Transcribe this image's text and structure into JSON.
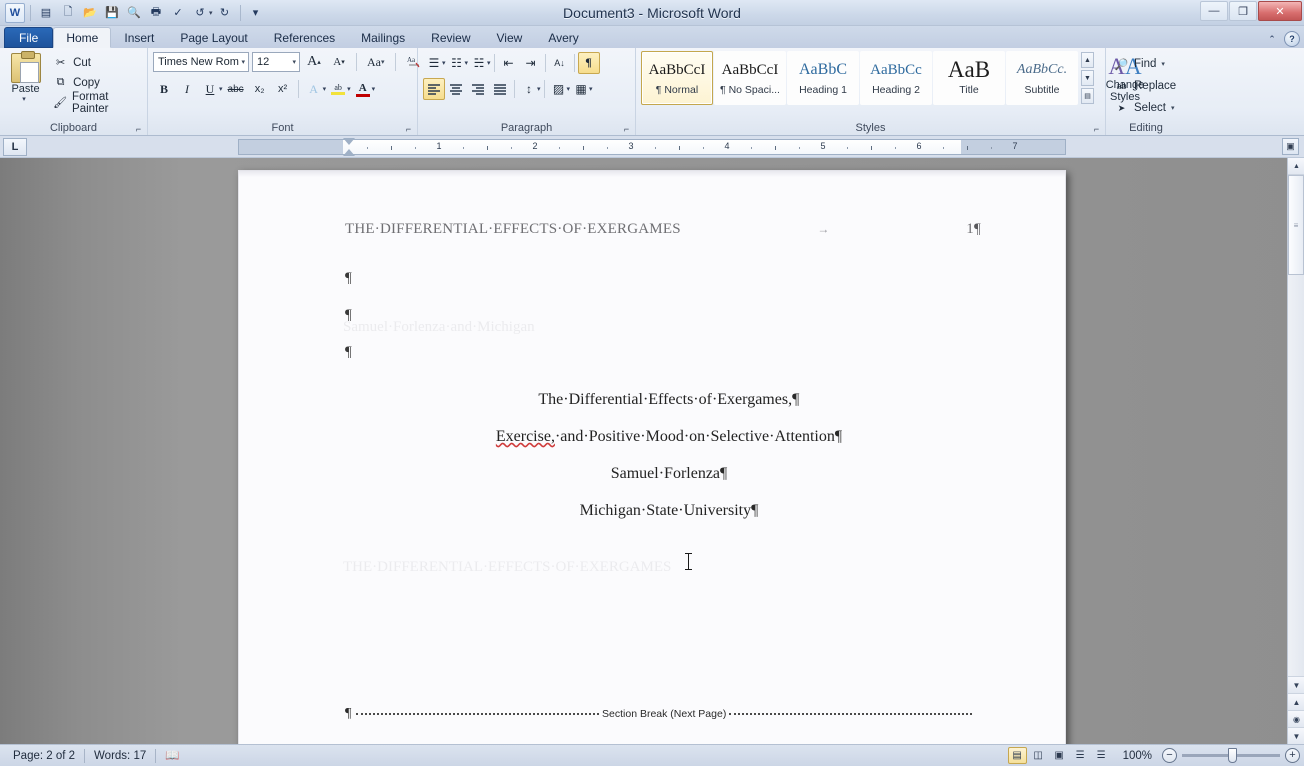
{
  "window": {
    "title": "Document3 - Microsoft Word",
    "minimize": "—",
    "restore": "❐",
    "close": "✕"
  },
  "quick_access": [
    {
      "name": "word-logo-icon",
      "glyph": "W"
    },
    {
      "name": "save-as-icon",
      "glyph": "▤"
    },
    {
      "name": "new-document-icon",
      "glyph": "🗋"
    },
    {
      "name": "open-icon",
      "glyph": "📂"
    },
    {
      "name": "save-icon",
      "glyph": "💾"
    },
    {
      "name": "print-preview-icon",
      "glyph": "🔍"
    },
    {
      "name": "quick-print-icon",
      "glyph": "🖶"
    },
    {
      "name": "spelling-grammar-icon",
      "glyph": "✓"
    },
    {
      "name": "undo-icon",
      "glyph": "↺"
    },
    {
      "name": "redo-icon",
      "glyph": "↻"
    },
    {
      "name": "customize-qat-icon",
      "glyph": "▾"
    }
  ],
  "tabs": [
    {
      "label": "File",
      "state": "file"
    },
    {
      "label": "Home",
      "state": "active"
    },
    {
      "label": "Insert",
      "state": "normal"
    },
    {
      "label": "Page Layout",
      "state": "normal"
    },
    {
      "label": "References",
      "state": "normal"
    },
    {
      "label": "Mailings",
      "state": "normal"
    },
    {
      "label": "Review",
      "state": "normal"
    },
    {
      "label": "View",
      "state": "normal"
    },
    {
      "label": "Avery",
      "state": "normal"
    }
  ],
  "ribbon": {
    "minimize_ribbon": "⌃",
    "help": "?",
    "clipboard": {
      "label": "Clipboard",
      "paste": "Paste",
      "paste_caret": "▾",
      "items": [
        {
          "label": "Cut",
          "icon": "✂"
        },
        {
          "label": "Copy",
          "icon": "⧉"
        },
        {
          "label": "Format Painter",
          "icon": "🖌"
        }
      ],
      "dialog_launcher": "⌐"
    },
    "font": {
      "label": "Font",
      "font_name": "Times New Rom",
      "font_size": "12",
      "grow_font": "A",
      "shrink_font": "A",
      "change_case": "Aa",
      "clear_formatting": "Ab",
      "bold": "B",
      "italic": "I",
      "underline": "U",
      "strikethrough": "abc",
      "subscript": "x₂",
      "superscript": "x²",
      "text_effects": "A",
      "highlight": "ab",
      "font_color": "A",
      "dialog_launcher": "⌐"
    },
    "paragraph": {
      "label": "Paragraph",
      "bullets": "☰",
      "numbering": "☷",
      "multilevel": "☵",
      "decrease_indent": "⇤",
      "increase_indent": "⇥",
      "sort": "A↓",
      "show_marks": "¶",
      "align_left": "☰",
      "align_center": "☰",
      "align_right": "☰",
      "justify": "☰",
      "line_spacing": "↕",
      "shading": "▨",
      "borders": "▦",
      "dialog_launcher": "⌐"
    },
    "styles": {
      "label": "Styles",
      "gallery": [
        {
          "sample": "AaBbCcI",
          "name": "¶ Normal",
          "variant": "normal",
          "selected": true
        },
        {
          "sample": "AaBbCcI",
          "name": "¶ No Spaci...",
          "variant": "normal",
          "selected": false
        },
        {
          "sample": "AaBbC",
          "name": "Heading 1",
          "variant": "h1",
          "selected": false
        },
        {
          "sample": "AaBbCc",
          "name": "Heading 2",
          "variant": "h2",
          "selected": false
        },
        {
          "sample": "AaB",
          "name": "Title",
          "variant": "title",
          "selected": false
        },
        {
          "sample": "AaBbCc.",
          "name": "Subtitle",
          "variant": "subtitle",
          "selected": false
        }
      ],
      "nav_up": "▲",
      "nav_down": "▼",
      "nav_more": "▤",
      "change_styles": "Change Styles",
      "change_styles_caret": "▾",
      "dialog_launcher": "⌐"
    },
    "editing": {
      "label": "Editing",
      "items": [
        {
          "label": "Find",
          "icon": "🔎",
          "caret": "▾"
        },
        {
          "label": "Replace",
          "icon": "ab",
          "caret": ""
        },
        {
          "label": "Select",
          "icon": "➤",
          "caret": "▾"
        }
      ]
    }
  },
  "ruler": {
    "corner_tab_stop": "L",
    "numbers": [
      "1",
      "2",
      "3",
      "4",
      "5",
      "6",
      "7"
    ],
    "toggle_ruler_icon": "▣"
  },
  "document": {
    "header": {
      "text": "THE·DIFFERENTIAL·EFFECTS·OF·EXERGAMES",
      "tab_arrow": "→",
      "page_number": "1",
      "pilcrow": "¶"
    },
    "empty_paragraphs": [
      "¶",
      "¶",
      "¶"
    ],
    "body_lines": [
      {
        "text": "The·Differential·Effects·of·Exergames,",
        "pilcrow": "¶",
        "misspelled": ""
      },
      {
        "text": "·and·Positive·Mood·on·Selective·Attention",
        "pilcrow": "¶",
        "misspelled": "Exercise,"
      },
      {
        "text": "Samuel·Forlenza",
        "pilcrow": "¶",
        "misspelled": ""
      },
      {
        "text": "Michigan·State·University",
        "pilcrow": "¶",
        "misspelled": ""
      }
    ],
    "section_break": {
      "pilcrow": "¶",
      "label": "Section Break (Next Page)"
    }
  },
  "scrollbar": {
    "up_arrow": "▲",
    "down_arrow": "▼",
    "thumb_grip": "≡",
    "previous_page": "▲",
    "select_browse_object": "◉",
    "next_page": "▼"
  },
  "status_bar": {
    "page": "Page: 2 of 2",
    "words": "Words: 17",
    "proofing_icon": "📖",
    "views": [
      {
        "name": "print-layout-view",
        "icon": "▤",
        "active": true
      },
      {
        "name": "full-screen-reading-view",
        "icon": "◫",
        "active": false
      },
      {
        "name": "web-layout-view",
        "icon": "▣",
        "active": false
      },
      {
        "name": "outline-view",
        "icon": "☰",
        "active": false
      },
      {
        "name": "draft-view",
        "icon": "☰",
        "active": false
      }
    ],
    "zoom_level": "100%",
    "zoom_out": "−",
    "zoom_in": "+"
  }
}
